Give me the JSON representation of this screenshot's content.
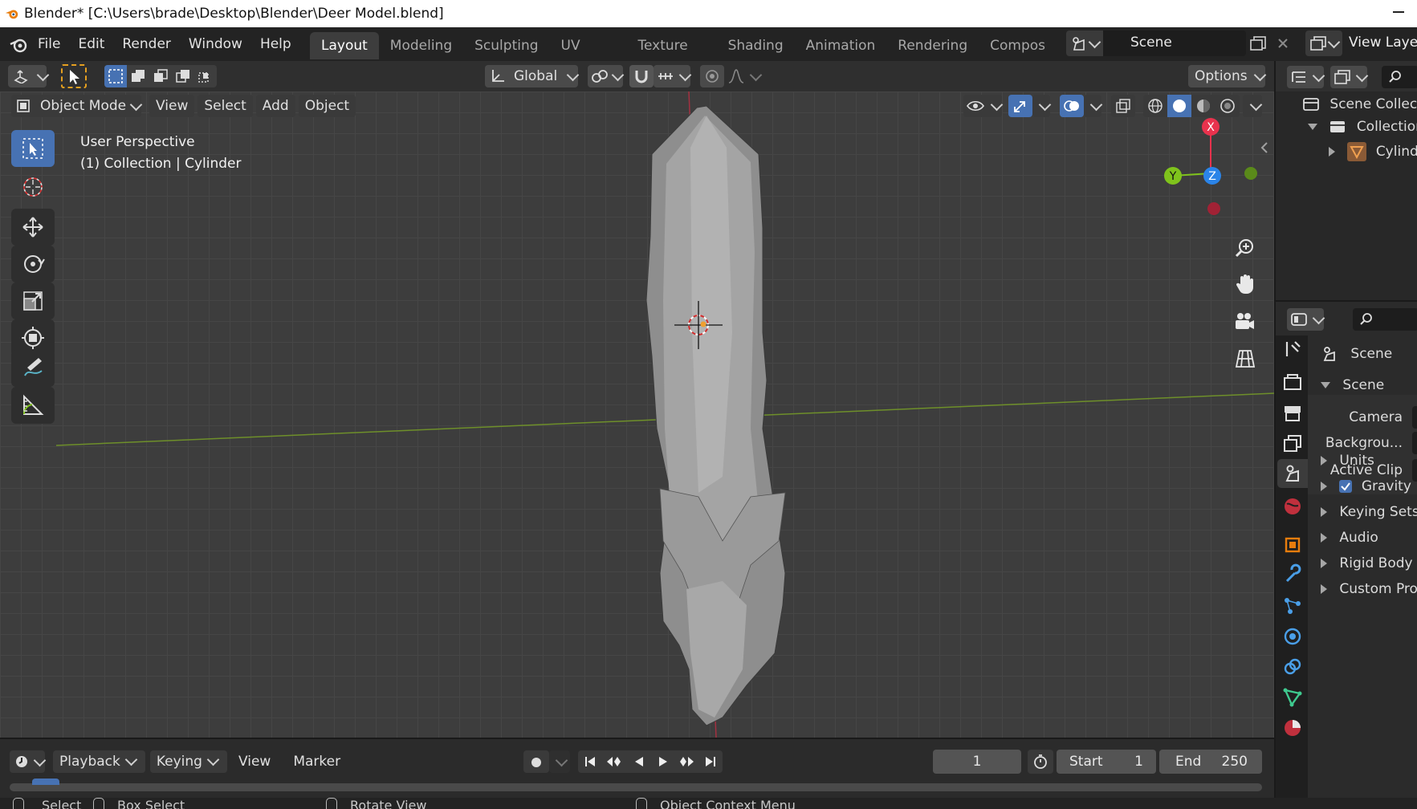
{
  "title_bar": {
    "text": "Blender* [C:\\Users\\brade\\Desktop\\Blender\\Deer Model.blend]"
  },
  "menu": {
    "items": [
      "File",
      "Edit",
      "Render",
      "Window",
      "Help"
    ]
  },
  "workspace_tabs": [
    {
      "label": "Layout",
      "active": true
    },
    {
      "label": "Modeling"
    },
    {
      "label": "Sculpting"
    },
    {
      "label": "UV Editing"
    },
    {
      "label": "Texture Paint"
    },
    {
      "label": "Shading"
    },
    {
      "label": "Animation"
    },
    {
      "label": "Rendering"
    },
    {
      "label": "Compos"
    }
  ],
  "scene_selector": {
    "value": "Scene"
  },
  "view_layer": {
    "label": "View Layer"
  },
  "viewport_header": {
    "transform_orientation": "Global",
    "options_label": "Options",
    "mode": "Object Mode",
    "menus": [
      "View",
      "Select",
      "Add",
      "Object"
    ]
  },
  "viewport": {
    "perspective_label": "User Perspective",
    "context_label": "(1) Collection | Cylinder",
    "gizmo": {
      "x": "X",
      "y": "Y",
      "z": "Z"
    }
  },
  "outliner": {
    "items": [
      {
        "label": "Scene Collection"
      },
      {
        "label": "Collection"
      },
      {
        "label": "Cylinder"
      }
    ]
  },
  "properties": {
    "header": "Scene",
    "section": "Scene",
    "fields": [
      {
        "label": "Camera"
      },
      {
        "label": "Backgrou..."
      },
      {
        "label": "Active Clip"
      }
    ],
    "panels": [
      {
        "label": "Units"
      },
      {
        "label": "Gravity",
        "checked": true
      },
      {
        "label": "Keying Sets"
      },
      {
        "label": "Audio"
      },
      {
        "label": "Rigid Body W"
      },
      {
        "label": "Custom Prop"
      }
    ]
  },
  "timeline": {
    "menus": [
      "Playback",
      "Keying",
      "View",
      "Marker"
    ],
    "current_frame": "1",
    "start_label": "Start",
    "start_value": "1",
    "end_label": "End",
    "end_value": "250"
  },
  "status_bar": {
    "items": [
      "Select",
      "Box Select",
      "Rotate View",
      "Object Context Menu"
    ]
  },
  "colors": {
    "accent_blue": "#4772b3",
    "axis_x": "#e8324d",
    "axis_y": "#7fc31c",
    "axis_z": "#2b84e8"
  }
}
